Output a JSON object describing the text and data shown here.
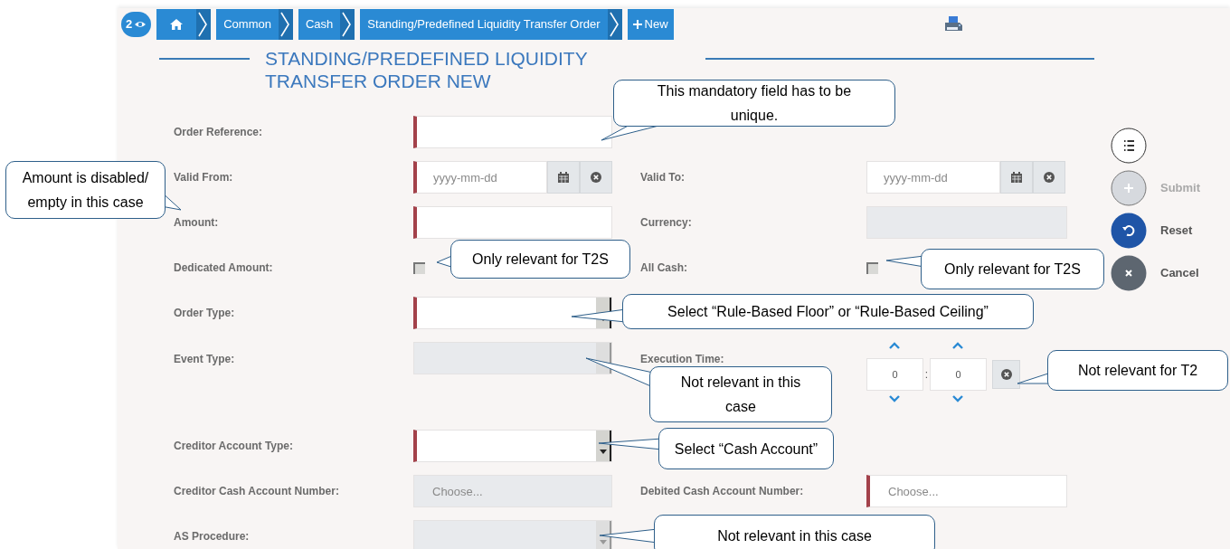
{
  "breadcrumb": {
    "counter": "2",
    "items": [
      {
        "kind": "home"
      },
      {
        "kind": "link",
        "label": "Common"
      },
      {
        "kind": "link",
        "label": "Cash"
      },
      {
        "kind": "link",
        "label": "Standing/Predefined Liquidity Transfer Order"
      },
      {
        "kind": "action",
        "label": "New"
      }
    ]
  },
  "title": "STANDING/PREDEFINED LIQUIDITY TRANSFER ORDER NEW",
  "rows": [
    {
      "label": "Order Reference:",
      "field": {
        "kind": "text",
        "mandatory": true,
        "disabled": false
      }
    },
    {
      "label": "Valid From:",
      "field": {
        "kind": "date",
        "placeholder": "yyyy-mm-dd",
        "mandatory": true,
        "disabled": false
      },
      "right_label": "Valid To:",
      "right_field": {
        "kind": "date",
        "placeholder": "yyyy-mm-dd",
        "mandatory": false,
        "disabled": false
      }
    },
    {
      "label": "Amount:",
      "field": {
        "kind": "text",
        "mandatory": true,
        "disabled": false
      },
      "right_label": "Currency:",
      "right_field": {
        "kind": "text",
        "mandatory": false,
        "disabled": true
      }
    },
    {
      "label": "Dedicated Amount:",
      "field": {
        "kind": "checkbox",
        "checked": false
      },
      "right_label": "All Cash:",
      "right_field": {
        "kind": "checkbox",
        "checked": false
      }
    },
    {
      "label": "Order Type:",
      "field": {
        "kind": "select",
        "mandatory": true,
        "disabled": false
      }
    },
    {
      "label": "Event Type:",
      "field": {
        "kind": "select",
        "mandatory": false,
        "disabled": true
      },
      "right_label": "Execution Time:",
      "right_field": {
        "kind": "time",
        "hours": "0",
        "separator": ":",
        "minutes": "0"
      }
    },
    {
      "label": "Creditor Account Type:",
      "field": {
        "kind": "select",
        "mandatory": true,
        "disabled": false
      }
    },
    {
      "label": "Creditor Cash Account Number:",
      "field": {
        "kind": "text",
        "placeholder": "Choose...",
        "mandatory": false,
        "disabled": true
      },
      "right_label": "Debited Cash Account Number:",
      "right_field": {
        "kind": "text",
        "placeholder": "Choose...",
        "mandatory": true,
        "disabled": false
      }
    },
    {
      "label": "AS Procedure:",
      "field": {
        "kind": "select",
        "mandatory": false,
        "disabled": true
      }
    }
  ],
  "actions": [
    {
      "kind": "list"
    },
    {
      "kind": "submit",
      "label": "Submit",
      "disabled": true
    },
    {
      "kind": "reset",
      "label": "Reset",
      "disabled": false
    },
    {
      "kind": "cancel",
      "label": "Cancel",
      "disabled": false
    }
  ],
  "callouts": [
    "This mandatory field has to be unique.",
    "Amount is disabled/ empty in this case",
    "Only relevant for T2S",
    "Only relevant for T2S",
    "Select “Rule-Based Floor” or “Rule-Based Ceiling”",
    "Not relevant in this case",
    "Not relevant for T2",
    "Select “Cash Account”",
    "Not relevant in this case"
  ]
}
